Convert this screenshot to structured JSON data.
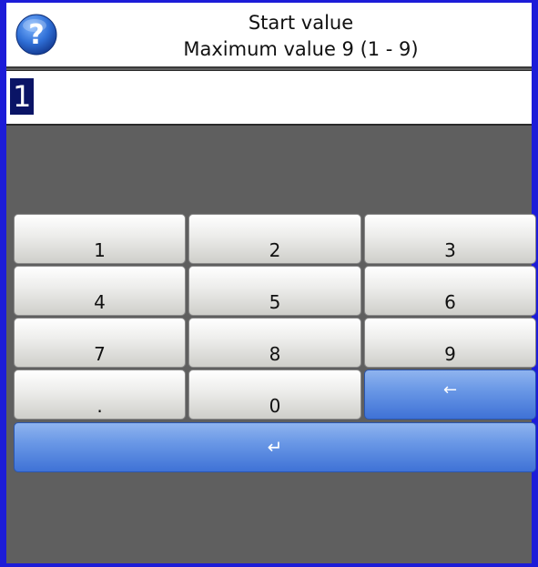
{
  "header": {
    "title": "Start value",
    "subtitle": "Maximum value 9 (1 - 9)",
    "help_icon": "question-mark-help-icon"
  },
  "input": {
    "value": "1"
  },
  "keypad": {
    "keys": [
      {
        "label": "1",
        "type": "digit"
      },
      {
        "label": "2",
        "type": "digit"
      },
      {
        "label": "3",
        "type": "digit"
      },
      {
        "label": "4",
        "type": "digit"
      },
      {
        "label": "5",
        "type": "digit"
      },
      {
        "label": "6",
        "type": "digit"
      },
      {
        "label": "7",
        "type": "digit"
      },
      {
        "label": "8",
        "type": "digit"
      },
      {
        "label": "9",
        "type": "digit"
      },
      {
        "label": ".",
        "type": "decimal"
      },
      {
        "label": "0",
        "type": "digit"
      },
      {
        "label": "←",
        "type": "backspace",
        "icon": "backspace-arrow-icon"
      },
      {
        "label": "↵",
        "type": "enter",
        "icon": "enter-return-icon"
      }
    ]
  },
  "colors": {
    "window_border": "#1c1cd8",
    "background": "#5f5f5f",
    "key_blue": "#4f82de",
    "selection": "#0a1466"
  }
}
